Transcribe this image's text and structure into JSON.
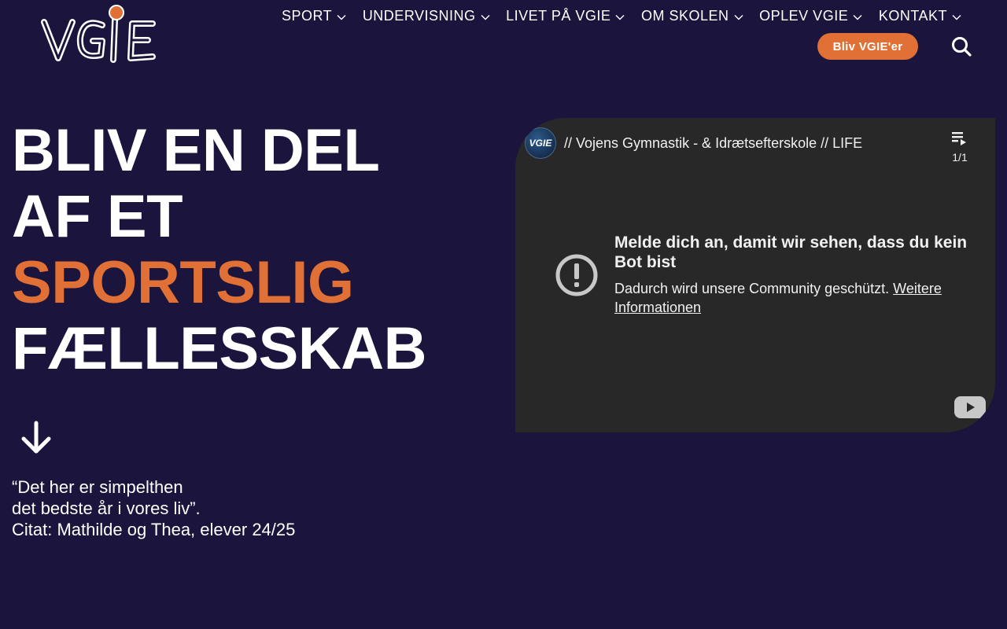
{
  "brand": {
    "logo_text": "VGIE",
    "accent_color": "#e07035",
    "background_color": "#1b143c"
  },
  "nav": {
    "items": [
      {
        "label": "SPORT"
      },
      {
        "label": "UNDERVISNING"
      },
      {
        "label": "LIVET PÅ VGIE"
      },
      {
        "label": "OM SKOLEN"
      },
      {
        "label": "OPLEV VGIE"
      },
      {
        "label": "KONTAKT"
      }
    ],
    "cta_label": "Bliv VGIE'er",
    "search_icon": "search-icon"
  },
  "hero": {
    "title_lines": [
      "BLIV EN DEL",
      "AF ET",
      "SPORTSLIG",
      "FÆLLESSKAB"
    ],
    "quote_lines": [
      "“Det her er simpelthen",
      "det bedste år i vores liv”.",
      "Citat: Mathilde og Thea, elever 24/25"
    ]
  },
  "video": {
    "channel_avatar_text": "VGIE",
    "title": "// Vojens Gymnastik - & Idrætsefterskole // LIFE",
    "playlist_count": "1/1",
    "message_title": "Melde dich an, damit wir sehen, dass du kein Bot bist",
    "message_body": "Dadurch wird unsere Community geschützt.",
    "message_link": "Weitere Informationen"
  }
}
